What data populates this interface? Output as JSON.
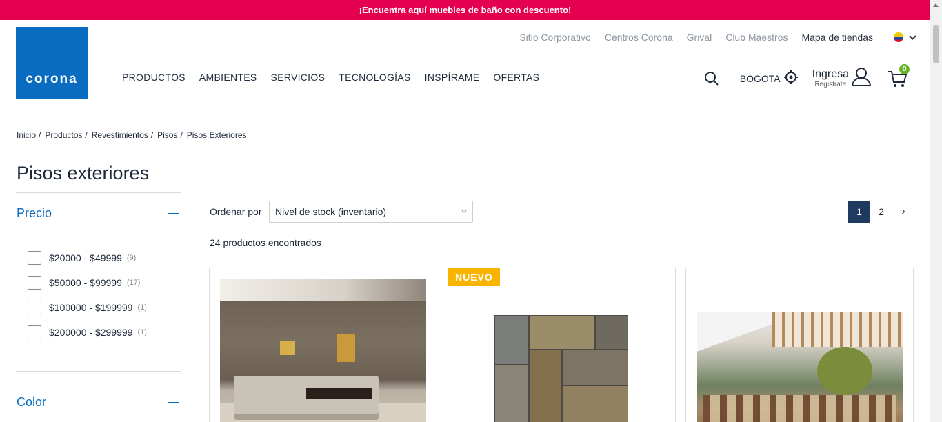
{
  "promo": {
    "prefix": "¡Encuentra ",
    "link": "aquí muebles de baño",
    "suffix": " con descuento!"
  },
  "header": {
    "logo": "corona",
    "top_links": [
      "Sitio Corporativo",
      "Centros Corona",
      "Grival",
      "Club Maestros",
      "Mapa de tiendas"
    ],
    "nav": [
      "PRODUCTOS",
      "AMBIENTES",
      "SERVICIOS",
      "TECNOLOGÍAS",
      "INSPÍRAME",
      "OFERTAS"
    ],
    "city": "BOGOTA",
    "login_main": "Ingresa",
    "login_sub": "Registrate",
    "cart_count": "0"
  },
  "breadcrumb": [
    "Inicio",
    "Productos",
    "Revestimientos",
    "Pisos",
    "Pisos Exteriores"
  ],
  "page_title": "Pisos exteriores",
  "filters": {
    "price_title": "Precio",
    "price_options": [
      {
        "label": "$20000 - $49999",
        "count": "(9)"
      },
      {
        "label": "$50000 - $99999",
        "count": "(17)"
      },
      {
        "label": "$100000 - $199999",
        "count": "(1)"
      },
      {
        "label": "$200000 - $299999",
        "count": "(1)"
      }
    ],
    "color_title": "Color"
  },
  "sort": {
    "label": "Ordenar por",
    "selected": "Nivel de stock (inventario)"
  },
  "pagination": {
    "pages": [
      "1",
      "2"
    ],
    "active": "1",
    "next": "›"
  },
  "results_count": "24 productos encontrados",
  "products": [
    {
      "badge": ""
    },
    {
      "badge": "NUEVO"
    },
    {
      "badge": ""
    }
  ],
  "colors": {
    "promo_bg": "#e5004f",
    "brand_blue": "#0a6cc1",
    "active_page": "#1f3a60",
    "badge": "#f8b400",
    "cart_badge": "#6ab42d"
  }
}
